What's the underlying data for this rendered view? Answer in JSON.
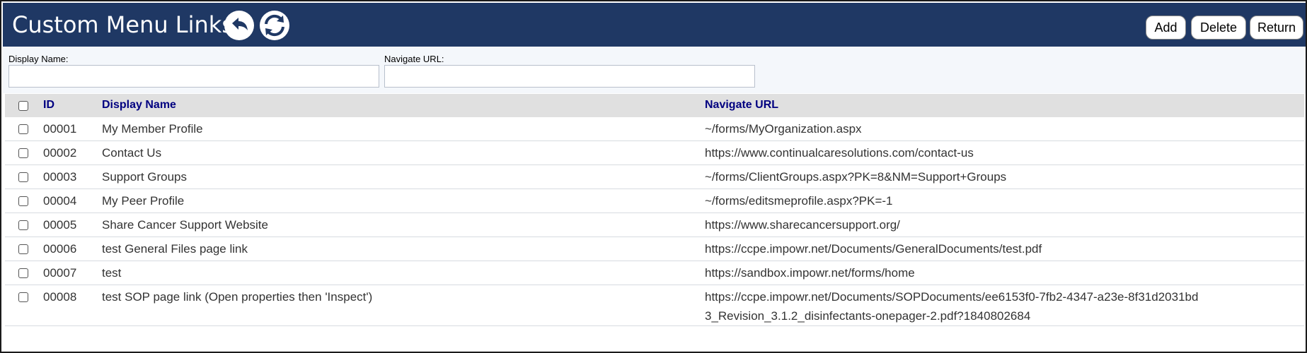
{
  "header": {
    "title": "Custom Menu Links",
    "icons": [
      "undo-icon",
      "refresh-icon"
    ],
    "buttons": {
      "add": "Add",
      "delete": "Delete",
      "return": "Return"
    },
    "colors": {
      "bar": "#1f3864",
      "text": "#ffffff"
    }
  },
  "filters": {
    "display_name_label": "Display Name:",
    "display_name_value": "",
    "navigate_url_label": "Navigate URL:",
    "navigate_url_value": ""
  },
  "table": {
    "columns": {
      "id": "ID",
      "display_name": "Display Name",
      "navigate_url": "Navigate URL"
    },
    "header_color": "#000080",
    "rows": [
      {
        "id": "00001",
        "display_name": "My Member Profile",
        "navigate_url": "~/forms/MyOrganization.aspx"
      },
      {
        "id": "00002",
        "display_name": "Contact Us",
        "navigate_url": "https://www.continualcaresolutions.com/contact-us"
      },
      {
        "id": "00003",
        "display_name": "Support Groups",
        "navigate_url": "~/forms/ClientGroups.aspx?PK=8&NM=Support+Groups"
      },
      {
        "id": "00004",
        "display_name": "My Peer Profile",
        "navigate_url": "~/forms/editsmeprofile.aspx?PK=-1"
      },
      {
        "id": "00005",
        "display_name": "Share Cancer Support Website",
        "navigate_url": "https://www.sharecancersupport.org/"
      },
      {
        "id": "00006",
        "display_name": "test General Files page link",
        "navigate_url": "https://ccpe.impowr.net/Documents/GeneralDocuments/test.pdf"
      },
      {
        "id": "00007",
        "display_name": "test",
        "navigate_url": "https://sandbox.impowr.net/forms/home"
      },
      {
        "id": "00008",
        "display_name": "test SOP page link (Open properties then 'Inspect')",
        "navigate_url": "https://ccpe.impowr.net/Documents/SOPDocuments/ee6153f0-7fb2-4347-a23e-8f31d2031bd3_Revision_3.1.2_disinfectants-onepager-2.pdf?1840802684"
      }
    ]
  }
}
